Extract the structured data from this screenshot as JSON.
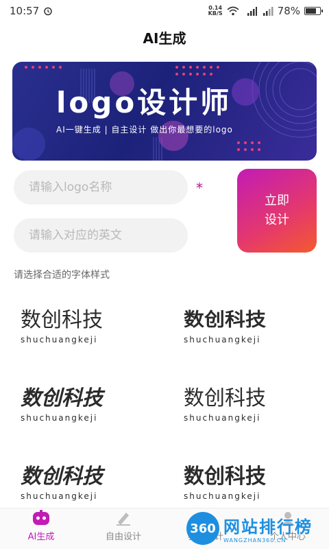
{
  "status_bar": {
    "time": "10:57",
    "net_speed_value": "0.14",
    "net_speed_unit": "KB/S",
    "battery_percent": "78%",
    "battery_level": 0.78
  },
  "header": {
    "title": "AI生成"
  },
  "banner": {
    "title": "logo设计师",
    "subtitle": "AI一键生成 | 自主设计    做出你最想要的logo"
  },
  "form": {
    "name_placeholder": "请输入logo名称",
    "english_placeholder": "请输入对应的英文",
    "required_mark": "*",
    "design_button_line1": "立即",
    "design_button_line2": "设计",
    "section_label": "请选择合适的字体样式"
  },
  "font_options": [
    {
      "text": "数创科技",
      "pinyin": "shuchuangkeji"
    },
    {
      "text": "数创科技",
      "pinyin": "shuchuangkeji"
    },
    {
      "text": "数创科技",
      "pinyin": "shuchuangkeji"
    },
    {
      "text": "数创科技",
      "pinyin": "shuchuangkeji"
    },
    {
      "text": "数创科技",
      "pinyin": "shuchuangkeji"
    },
    {
      "text": "数创科技",
      "pinyin": "shuchuangkeji"
    }
  ],
  "tabs": [
    {
      "label": "AI生成",
      "icon": "robot-icon",
      "active": true
    },
    {
      "label": "自由设计",
      "icon": "pen-icon",
      "active": false
    },
    {
      "label": "我的设计",
      "icon": "folder-icon",
      "active": false
    },
    {
      "label": "个人中心",
      "icon": "user-icon",
      "active": false
    }
  ],
  "watermark": {
    "badge": "360",
    "title": "网站排行榜",
    "url": "WANGZHAN360.CN"
  },
  "colors": {
    "accent": "#c21bb6",
    "button_gradient_end": "#f45a2e",
    "banner_bg": "#1c2279",
    "watermark_blue": "#1e8fe0"
  }
}
